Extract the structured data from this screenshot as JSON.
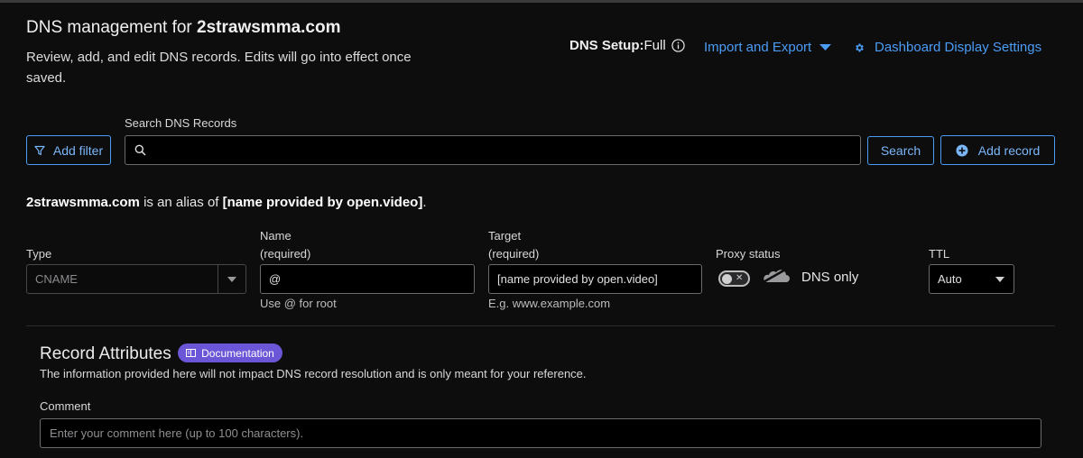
{
  "header": {
    "title_prefix": "DNS management for ",
    "domain": "2strawsmma.com",
    "subtitle": "Review, add, and edit DNS records. Edits will go into effect once saved.",
    "setup_label": "DNS Setup:",
    "setup_value": "Full",
    "import_export": "Import and Export",
    "dashboard_settings": "Dashboard Display Settings"
  },
  "search": {
    "label": "Search DNS Records",
    "placeholder": "",
    "add_filter": "Add filter",
    "search_button": "Search",
    "add_record": "Add record"
  },
  "alias": {
    "domain": "2strawsmma.com",
    "middle": " is an alias of ",
    "target": "[name provided by open.video]",
    "end": "."
  },
  "form": {
    "type_label": "Type",
    "type_value": "CNAME",
    "name_label": "Name",
    "name_required": "(required)",
    "name_value": "@",
    "name_hint": "Use @ for root",
    "target_label": "Target",
    "target_required": "(required)",
    "target_value": "[name provided by open.video]",
    "target_hint": "E.g. www.example.com",
    "proxy_label": "Proxy status",
    "proxy_value": "DNS only",
    "ttl_label": "TTL",
    "ttl_value": "Auto"
  },
  "attributes": {
    "title": "Record Attributes",
    "doc_badge": "Documentation",
    "description": "The information provided here will not impact DNS record resolution and is only meant for your reference.",
    "comment_label": "Comment",
    "comment_placeholder": "Enter your comment here (up to 100 characters)."
  },
  "colors": {
    "accent": "#4b9cf5",
    "badge": "#6a56d6",
    "background": "#0d0d0e"
  },
  "icons": [
    "info-icon",
    "caret-down-icon",
    "gear-icon",
    "filter-icon",
    "search-icon",
    "plus-circle-icon",
    "chevron-down-icon",
    "cloud-icon",
    "book-icon"
  ]
}
